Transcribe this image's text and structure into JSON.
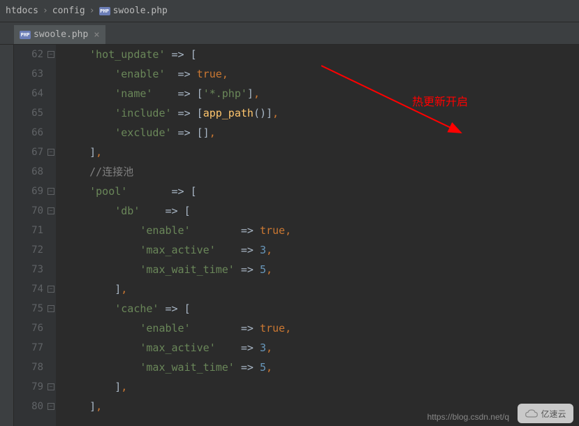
{
  "breadcrumbs": {
    "items": [
      "htdocs",
      "config",
      "swoole.php"
    ]
  },
  "tabs": {
    "active": {
      "label": "swoole.php"
    }
  },
  "gutter": {
    "start": 62,
    "end": 80
  },
  "annotation": {
    "text": "热更新开启"
  },
  "code": {
    "lines": [
      {
        "n": 62,
        "indent": 2,
        "tokens": [
          [
            "str",
            "'hot_update'"
          ],
          [
            "op",
            " => "
          ],
          [
            "bracket",
            "["
          ]
        ]
      },
      {
        "n": 63,
        "indent": 3,
        "tokens": [
          [
            "str",
            "'enable'"
          ],
          [
            "op",
            "  => "
          ],
          [
            "bool",
            "true"
          ],
          [
            "orange",
            ","
          ]
        ]
      },
      {
        "n": 64,
        "indent": 3,
        "tokens": [
          [
            "str",
            "'name'"
          ],
          [
            "op",
            "    => "
          ],
          [
            "bracket",
            "["
          ],
          [
            "str",
            "'*.php'"
          ],
          [
            "bracket",
            "]"
          ],
          [
            "orange",
            ","
          ]
        ]
      },
      {
        "n": 65,
        "indent": 3,
        "tokens": [
          [
            "str",
            "'include'"
          ],
          [
            "op",
            " => "
          ],
          [
            "bracket",
            "["
          ],
          [
            "func",
            "app_path"
          ],
          [
            "op",
            "()"
          ],
          [
            "bracket",
            "]"
          ],
          [
            "orange",
            ","
          ]
        ]
      },
      {
        "n": 66,
        "indent": 3,
        "tokens": [
          [
            "str",
            "'exclude'"
          ],
          [
            "op",
            " => "
          ],
          [
            "bracket",
            "[]"
          ],
          [
            "orange",
            ","
          ]
        ]
      },
      {
        "n": 67,
        "indent": 2,
        "tokens": [
          [
            "bracket",
            "]"
          ],
          [
            "orange",
            ","
          ]
        ]
      },
      {
        "n": 68,
        "indent": 2,
        "tokens": [
          [
            "comment",
            "//"
          ],
          [
            "comment-cn",
            "连接池"
          ]
        ]
      },
      {
        "n": 69,
        "indent": 2,
        "tokens": [
          [
            "str",
            "'pool'"
          ],
          [
            "op",
            "       => "
          ],
          [
            "bracket",
            "["
          ]
        ]
      },
      {
        "n": 70,
        "indent": 3,
        "tokens": [
          [
            "str",
            "'db'"
          ],
          [
            "op",
            "    => "
          ],
          [
            "bracket",
            "["
          ]
        ]
      },
      {
        "n": 71,
        "indent": 4,
        "tokens": [
          [
            "str",
            "'enable'"
          ],
          [
            "op",
            "        => "
          ],
          [
            "bool",
            "true"
          ],
          [
            "orange",
            ","
          ]
        ]
      },
      {
        "n": 72,
        "indent": 4,
        "tokens": [
          [
            "str",
            "'max_active'"
          ],
          [
            "op",
            "    => "
          ],
          [
            "num",
            "3"
          ],
          [
            "orange",
            ","
          ]
        ]
      },
      {
        "n": 73,
        "indent": 4,
        "tokens": [
          [
            "str",
            "'max_wait_time'"
          ],
          [
            "op",
            " => "
          ],
          [
            "num",
            "5"
          ],
          [
            "orange",
            ","
          ]
        ]
      },
      {
        "n": 74,
        "indent": 3,
        "tokens": [
          [
            "bracket",
            "]"
          ],
          [
            "orange",
            ","
          ]
        ]
      },
      {
        "n": 75,
        "indent": 3,
        "tokens": [
          [
            "str",
            "'cache'"
          ],
          [
            "op",
            " => "
          ],
          [
            "bracket",
            "["
          ]
        ]
      },
      {
        "n": 76,
        "indent": 4,
        "tokens": [
          [
            "str",
            "'enable'"
          ],
          [
            "op",
            "        => "
          ],
          [
            "bool",
            "true"
          ],
          [
            "orange",
            ","
          ]
        ]
      },
      {
        "n": 77,
        "indent": 4,
        "tokens": [
          [
            "str",
            "'max_active'"
          ],
          [
            "op",
            "    => "
          ],
          [
            "num",
            "3"
          ],
          [
            "orange",
            ","
          ]
        ]
      },
      {
        "n": 78,
        "indent": 4,
        "tokens": [
          [
            "str",
            "'max_wait_time'"
          ],
          [
            "op",
            " => "
          ],
          [
            "num",
            "5"
          ],
          [
            "orange",
            ","
          ]
        ]
      },
      {
        "n": 79,
        "indent": 3,
        "tokens": [
          [
            "bracket",
            "]"
          ],
          [
            "orange",
            ","
          ]
        ]
      },
      {
        "n": 80,
        "indent": 2,
        "tokens": [
          [
            "bracket",
            "]"
          ],
          [
            "orange",
            ","
          ]
        ]
      }
    ]
  },
  "watermark": {
    "url": "https://blog.csdn.net/q",
    "logo": "亿速云"
  }
}
